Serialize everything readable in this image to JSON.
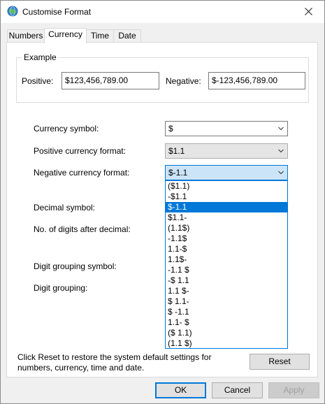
{
  "window": {
    "title": "Customise Format"
  },
  "tabs": [
    {
      "label": "Numbers",
      "active": false
    },
    {
      "label": "Currency",
      "active": true
    },
    {
      "label": "Time",
      "active": false
    },
    {
      "label": "Date",
      "active": false
    }
  ],
  "example": {
    "group_title": "Example",
    "positive_label": "Positive:",
    "positive_value": "$123,456,789.00",
    "negative_label": "Negative:",
    "negative_value": "$-123,456,789.00"
  },
  "settings": {
    "currency_symbol_label": "Currency symbol:",
    "currency_symbol_value": "$",
    "positive_format_label": "Positive currency format:",
    "positive_format_value": "$1.1",
    "negative_format_label": "Negative currency format:",
    "negative_format_value": "$-1.1",
    "decimal_symbol_label": "Decimal symbol:",
    "digits_after_decimal_label": "No. of digits after decimal:",
    "digit_grouping_symbol_label": "Digit grouping symbol:",
    "digit_grouping_label": "Digit grouping:"
  },
  "negative_format_options": [
    "($1.1)",
    "-$1.1",
    "$-1.1",
    "$1.1-",
    "(1.1$)",
    "-1.1$",
    "1.1-$",
    "1.1$-",
    "-1.1 $",
    "-$ 1.1",
    "1.1 $-",
    "$ 1.1-",
    "$ -1.1",
    "1.1- $",
    "($ 1.1)",
    "(1.1 $)"
  ],
  "negative_format_selected_index": 2,
  "footer": {
    "reset_note": "Click Reset to restore the system default settings for numbers, currency, time and date.",
    "reset_label": "Reset",
    "ok_label": "OK",
    "cancel_label": "Cancel",
    "apply_label": "Apply"
  },
  "colors": {
    "accent": "#0078d7",
    "selection_bg": "#0078d7",
    "open_combo_bg": "#cce4f7"
  },
  "icons": {
    "title": "globe-icon",
    "close": "close-icon",
    "combo": "chevron-down-icon"
  }
}
